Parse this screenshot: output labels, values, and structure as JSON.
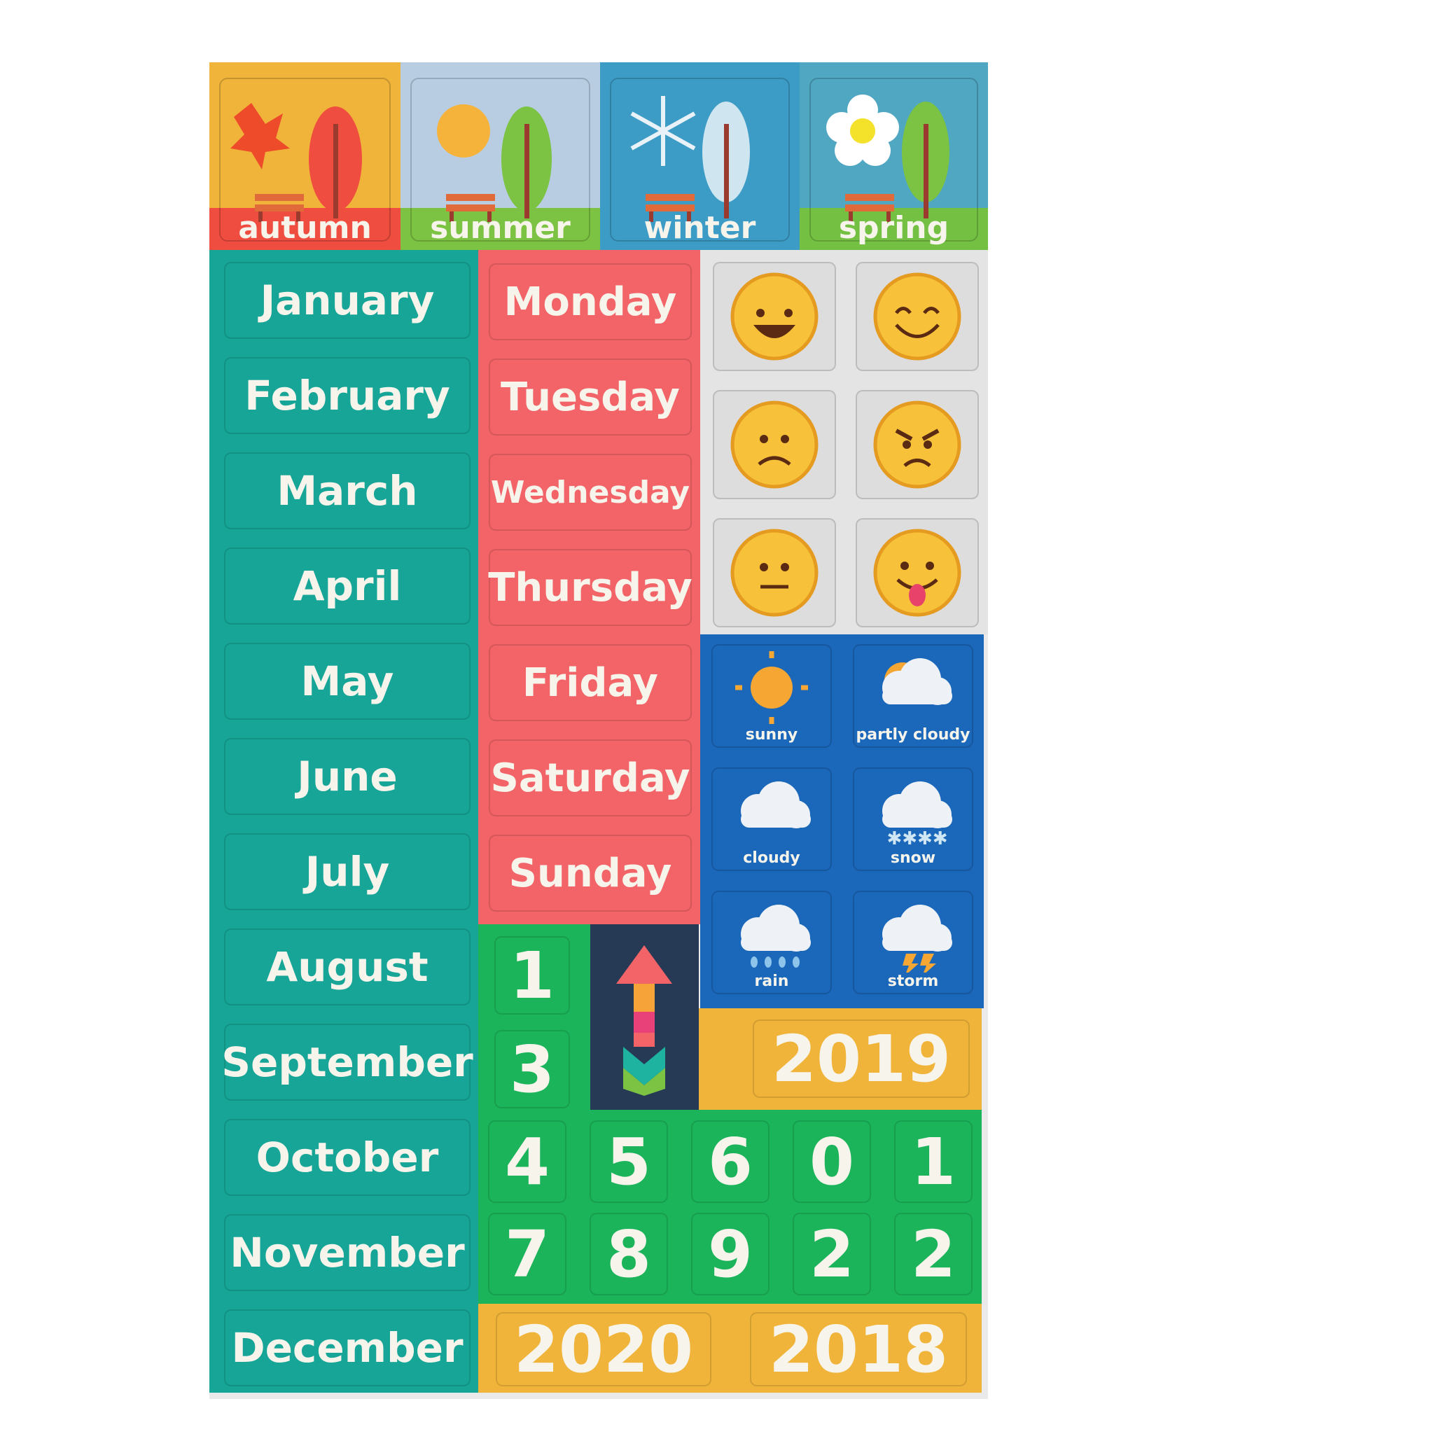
{
  "seasons": [
    {
      "label": "autumn",
      "bg": "#f0b43a",
      "band": "#ef4d3f"
    },
    {
      "label": "summer",
      "bg": "#b8cde2",
      "band": "#7cc243"
    },
    {
      "label": "winter",
      "bg": "#3c9cc6",
      "band": "#3c9cc6"
    },
    {
      "label": "spring",
      "bg": "#4fa7c2",
      "band": "#74c043"
    }
  ],
  "months": [
    "January",
    "February",
    "March",
    "April",
    "May",
    "June",
    "July",
    "August",
    "September",
    "October",
    "November",
    "December"
  ],
  "days": [
    "Monday",
    "Tuesday",
    "Wednesday",
    "Thursday",
    "Friday",
    "Saturday",
    "Sunday"
  ],
  "emotions": [
    {
      "icon": "grinning-face-icon"
    },
    {
      "icon": "smiling-eyes-face-icon"
    },
    {
      "icon": "frowning-face-icon"
    },
    {
      "icon": "angry-face-icon"
    },
    {
      "icon": "neutral-face-icon"
    },
    {
      "icon": "tongue-out-face-icon"
    }
  ],
  "weather": [
    {
      "label": "sunny",
      "icon": "sun-icon"
    },
    {
      "label": "partly cloudy",
      "icon": "partly-cloudy-icon"
    },
    {
      "label": "cloudy",
      "icon": "cloud-icon"
    },
    {
      "label": "snow",
      "icon": "snow-icon"
    },
    {
      "label": "rain",
      "icon": "rain-icon"
    },
    {
      "label": "storm",
      "icon": "storm-icon"
    }
  ],
  "numbers_top": [
    "1",
    "3"
  ],
  "numbers_row1": [
    "4",
    "5",
    "6",
    "0",
    "1"
  ],
  "numbers_row2": [
    "7",
    "8",
    "9",
    "2",
    "2"
  ],
  "years": {
    "middle": "2019",
    "bottom_left": "2020",
    "bottom_right": "2018"
  },
  "colors": {
    "teal": "#16a596",
    "red": "#f26467",
    "gray": "#dddddd",
    "blue": "#1b68bb",
    "green": "#1cb45a",
    "yellow": "#f0b43a",
    "navy": "#263a55"
  }
}
